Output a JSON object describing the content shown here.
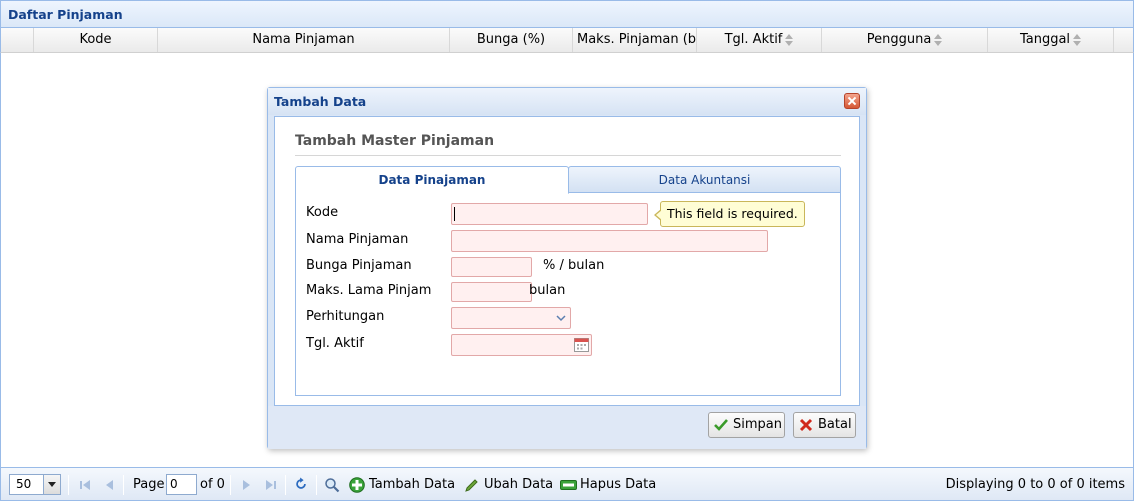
{
  "panel": {
    "title": "Daftar Pinjaman"
  },
  "grid": {
    "columns": [
      "Kode",
      "Nama Pinjaman",
      "Bunga (%)",
      "Maks. Pinjaman (bu",
      "Tgl. Aktif",
      "Pengguna",
      "Tanggal"
    ]
  },
  "toolbar": {
    "page_size": "50",
    "page_label": "Page",
    "page_value": "0",
    "of_label": "of 0",
    "add_label": "Tambah Data",
    "edit_label": "Ubah Data",
    "delete_label": "Hapus Data",
    "display_info": "Displaying 0 to 0 of 0 items"
  },
  "window": {
    "title": "Tambah Data",
    "form_title": "Tambah Master Pinjaman",
    "tabs": [
      "Data Pinajaman",
      "Data Akuntansi"
    ],
    "fields": {
      "kode": "Kode",
      "nama": "Nama Pinjaman",
      "bunga": "Bunga Pinjaman",
      "bunga_unit": "% / bulan",
      "maks": "Maks. Lama Pinjam",
      "maks_unit": "bulan",
      "perhitungan": "Perhitungan",
      "tgl": "Tgl. Aktif"
    },
    "tooltip": "This field is required.",
    "save_label": "Simpan",
    "cancel_label": "Batal"
  },
  "colors": {
    "accent": "#15428b",
    "border": "#99bbe8",
    "invalid_bg": "#fff0f0"
  }
}
